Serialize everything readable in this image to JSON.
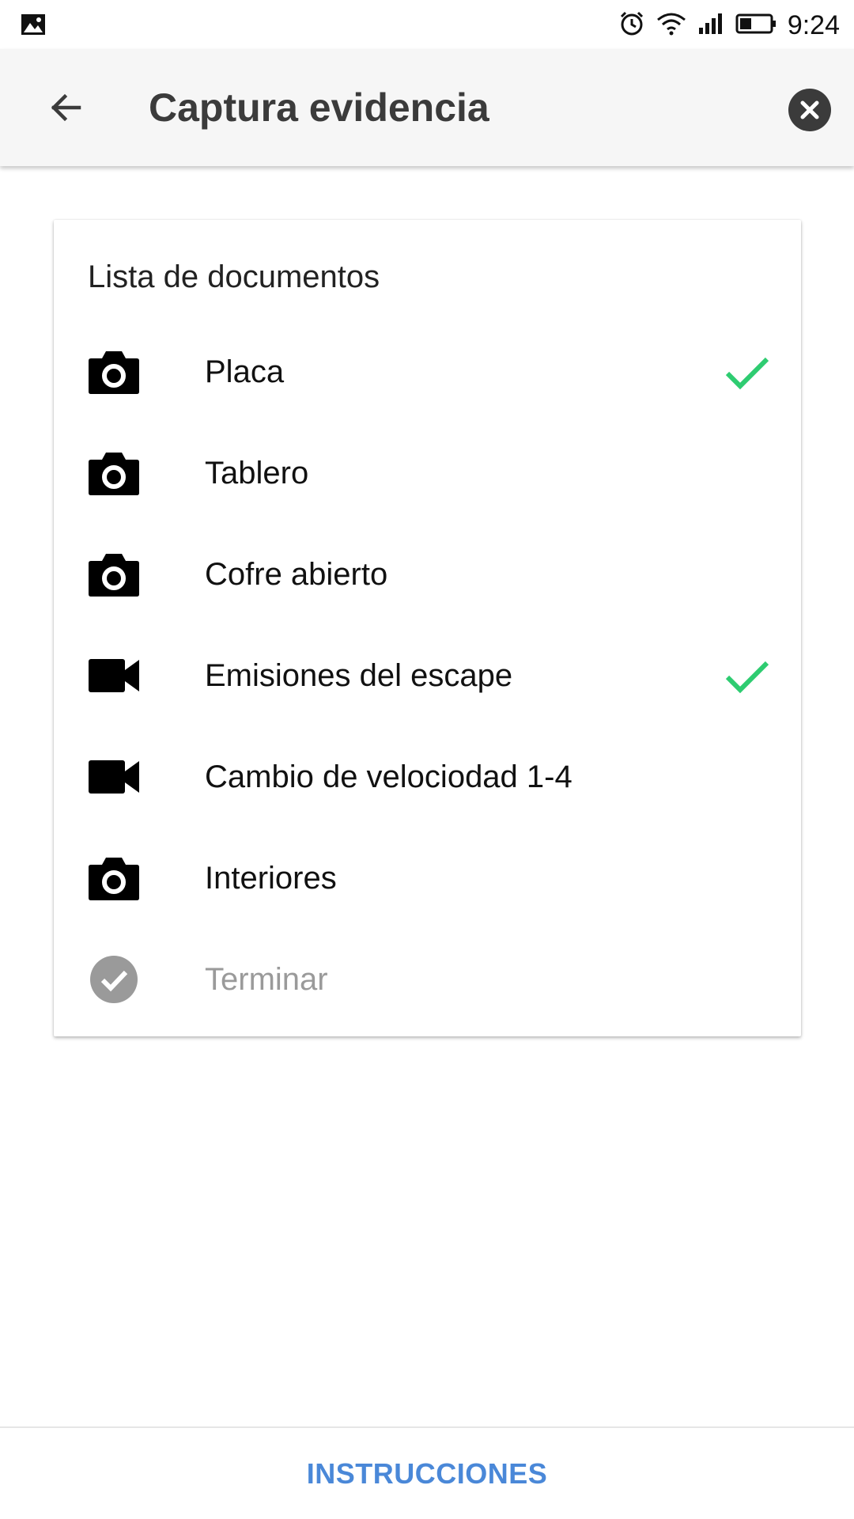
{
  "status_bar": {
    "time": "9:24",
    "icons": [
      "image-icon",
      "alarm-icon",
      "wifi-icon",
      "signal-icon",
      "battery-icon"
    ]
  },
  "app_bar": {
    "title": "Captura evidencia",
    "back_icon": "arrow-back-icon",
    "close_icon": "close-circle-icon"
  },
  "card": {
    "title": "Lista de documentos",
    "items": [
      {
        "label": "Placa",
        "icon": "camera-icon",
        "done": true
      },
      {
        "label": "Tablero",
        "icon": "camera-icon",
        "done": false
      },
      {
        "label": "Cofre abierto",
        "icon": "camera-icon",
        "done": false
      },
      {
        "label": "Emisiones del escape",
        "icon": "video-icon",
        "done": true
      },
      {
        "label": "Cambio de velociodad 1-4",
        "icon": "video-icon",
        "done": false
      },
      {
        "label": "Interiores",
        "icon": "camera-icon",
        "done": false
      },
      {
        "label": "Terminar",
        "icon": "check-circle-icon",
        "done": false,
        "disabled": true
      }
    ]
  },
  "bottom_bar": {
    "button_label": "INSTRUCCIONES"
  },
  "colors": {
    "accent": "#4a88d8",
    "check": "#2ecc71",
    "disabled": "#9a9a9a",
    "app_bar": "#f6f6f6"
  }
}
